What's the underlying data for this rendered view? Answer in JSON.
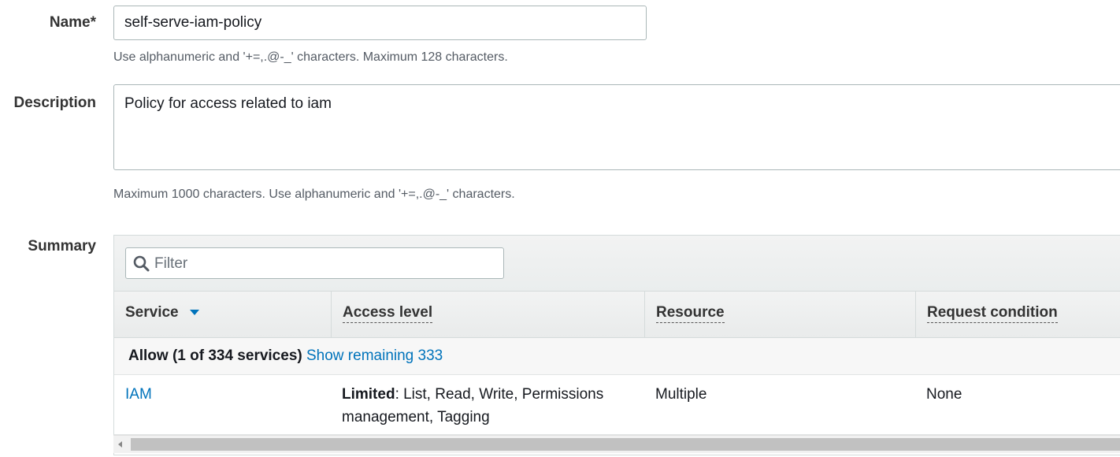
{
  "form": {
    "name_label": "Name*",
    "name_value": "self-serve-iam-policy",
    "name_hint": "Use alphanumeric and '+=,.@-_' characters. Maximum 128 characters.",
    "description_label": "Description",
    "description_value": "Policy for access related to iam",
    "description_hint": "Maximum 1000 characters. Use alphanumeric and '+=,.@-_' characters.",
    "summary_label": "Summary"
  },
  "summary": {
    "filter_placeholder": "Filter",
    "columns": [
      "Service",
      "Access level",
      "Resource",
      "Request condition"
    ],
    "group_label": "Allow (1 of 334 services)",
    "group_link": "Show remaining 333",
    "rows": [
      {
        "service": "IAM",
        "access_level_prefix": "Limited",
        "access_level_detail": ": List, Read, Write, Permissions management, Tagging",
        "resource": "Multiple",
        "request_condition": "None"
      }
    ]
  },
  "icons": {
    "search": "search-icon",
    "sort": "caret-down-icon",
    "scroll_left": "arrow-left-icon"
  },
  "colors": {
    "link": "#0073bb",
    "header_bg": "#eaeded",
    "border": "#aab7b8"
  }
}
